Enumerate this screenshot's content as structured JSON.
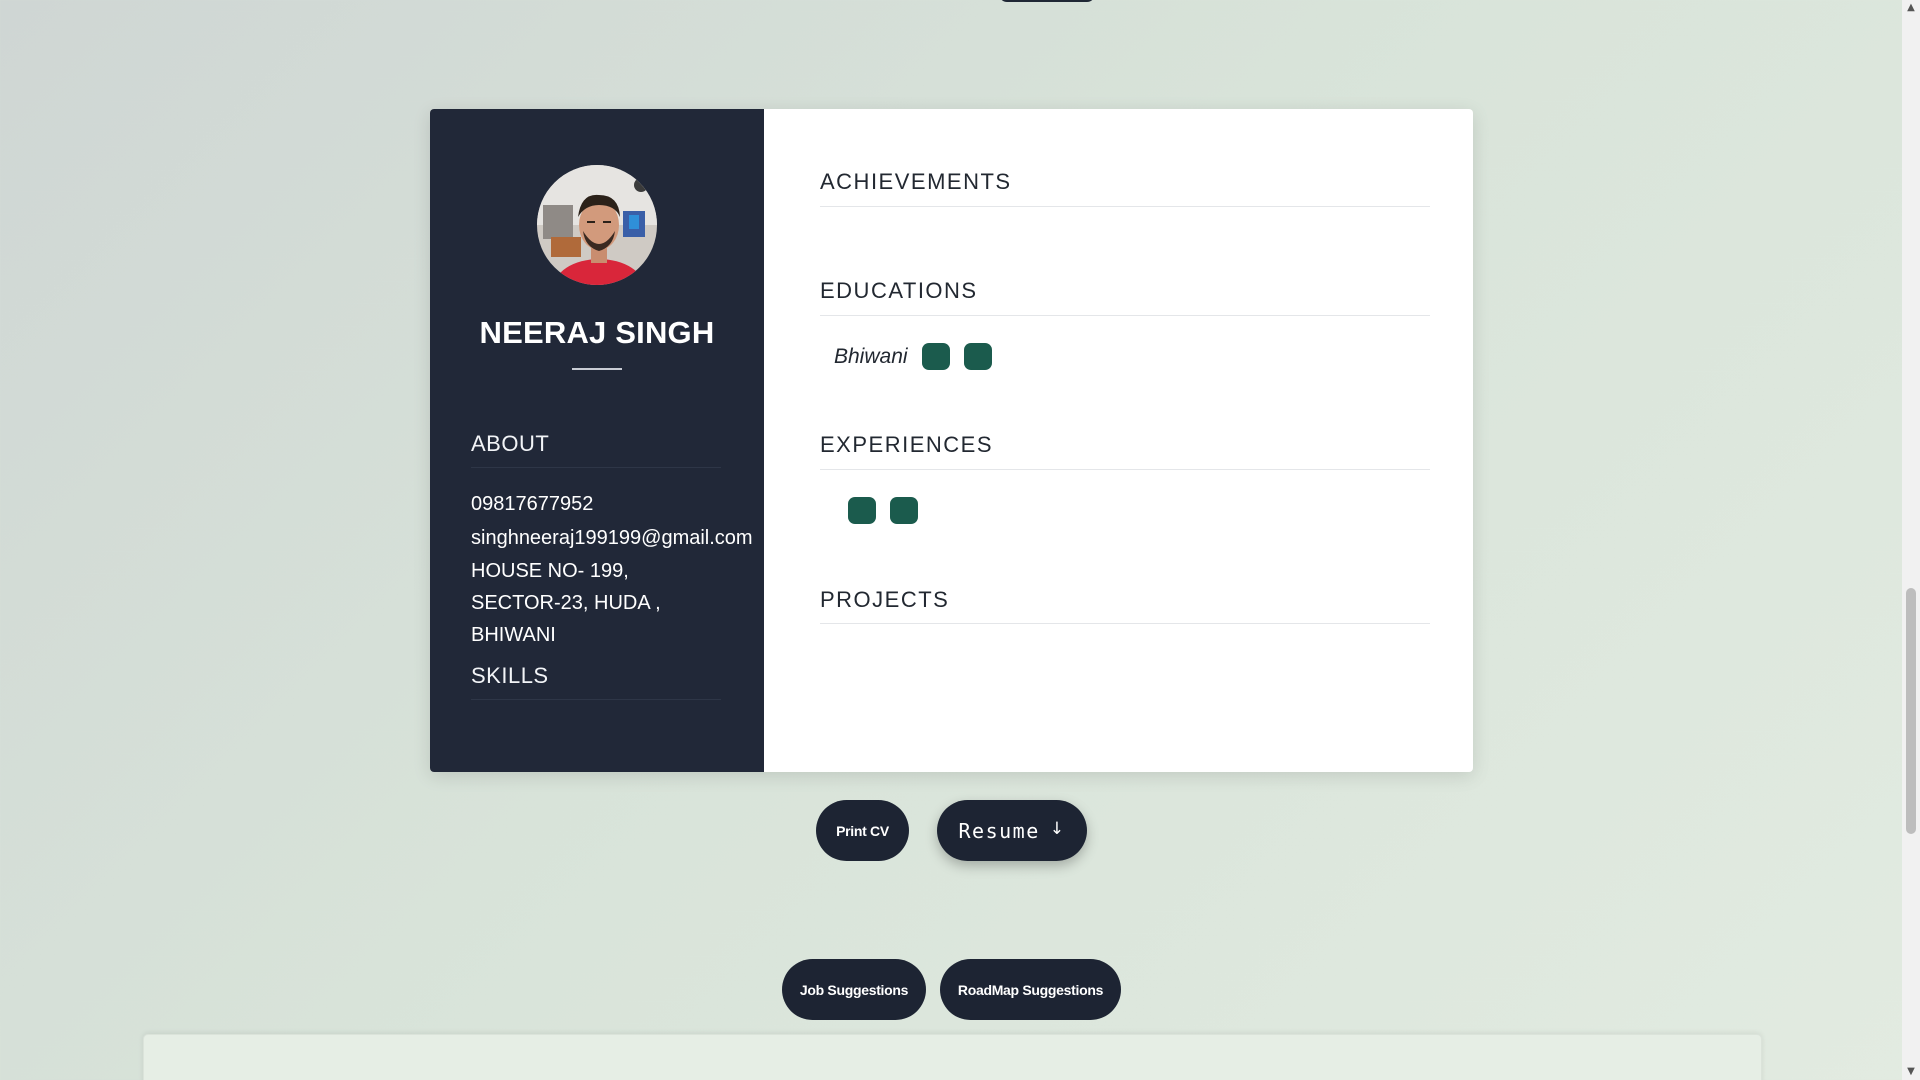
{
  "profile": {
    "name": "NEERAJ SINGH",
    "avatar_icon": "profile-photo"
  },
  "sidebar": {
    "about_heading": "ABOUT",
    "phone": "09817677952",
    "email": "singhneeraj199199@gmail.com",
    "address": "HOUSE NO- 199, SECTOR-23, HUDA , BHIWANI",
    "skills_heading": "SKILLS"
  },
  "main": {
    "achievements_heading": "ACHIEVEMENTS",
    "educations_heading": "EDUCATIONS",
    "education_place": "Bhiwani",
    "experiences_heading": "EXPERIENCES",
    "projects_heading": "PROJECTS"
  },
  "actions": {
    "print_label": "Print CV",
    "resume_label": "Resume",
    "resume_icon": "arrow-down-icon",
    "job_label": "Job Suggestions",
    "roadmap_label": "RoadMap Suggestions"
  },
  "colors": {
    "sidebar_bg": "#212838",
    "button_bg": "#1d2433",
    "chip": "#1b5b4d",
    "page_bg": "#d8e3d9"
  }
}
